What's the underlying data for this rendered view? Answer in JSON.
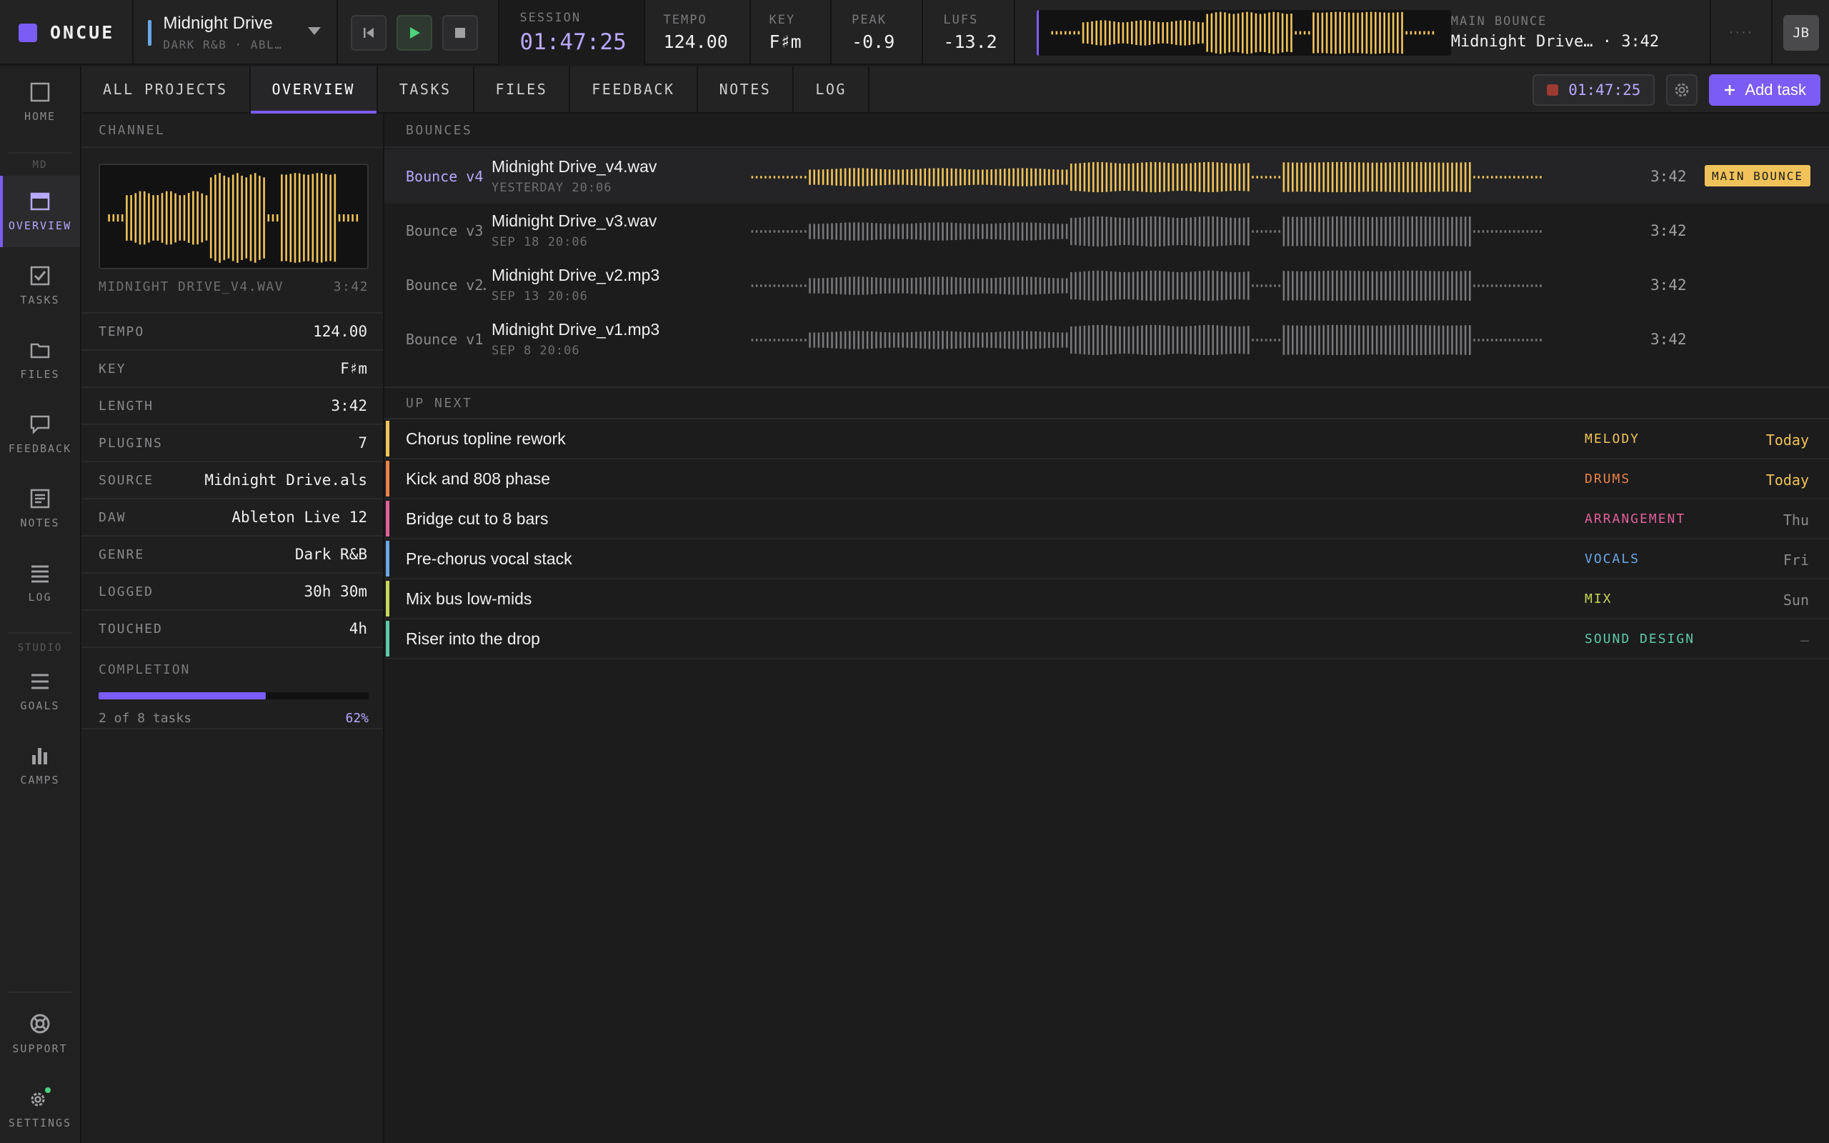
{
  "app": {
    "name": "ONCUE"
  },
  "project": {
    "title": "Midnight Drive",
    "subtitle": "DARK R&B · ABL…"
  },
  "stats": {
    "session": {
      "label": "SESSION",
      "value": "01:47:25"
    },
    "tempo": {
      "label": "TEMPO",
      "value": "124.00"
    },
    "key": {
      "label": "KEY",
      "value": "F♯m"
    },
    "peak": {
      "label": "PEAK",
      "value": "-0.9"
    },
    "lufs": {
      "label": "LUFS",
      "value": "-13.2"
    }
  },
  "main_bounce": {
    "label": "MAIN BOUNCE",
    "name": "Midnight Drive…",
    "length": "· 3:42"
  },
  "more_label": "····",
  "user": {
    "initials": "JB"
  },
  "rail": {
    "items": [
      {
        "label": "HOME",
        "icon": "square-icon"
      },
      {
        "label": "OVERVIEW",
        "icon": "window-icon"
      },
      {
        "label": "TASKS",
        "icon": "checkbox-icon"
      },
      {
        "label": "FILES",
        "icon": "folder-icon"
      },
      {
        "label": "FEEDBACK",
        "icon": "speech-bubble-icon"
      },
      {
        "label": "NOTES",
        "icon": "notes-icon"
      },
      {
        "label": "LOG",
        "icon": "list-icon"
      },
      {
        "label": "GOALS",
        "icon": "goals-icon"
      },
      {
        "label": "CAMPS",
        "icon": "bar-chart-icon"
      },
      {
        "label": "SUPPORT",
        "icon": "lifebuoy-icon"
      },
      {
        "label": "SETTINGS",
        "icon": "gear-icon"
      }
    ],
    "project_badge": "MD",
    "studio_label": "STUDIO"
  },
  "tabs": [
    "ALL PROJECTS",
    "OVERVIEW",
    "TASKS",
    "FILES",
    "FEEDBACK",
    "NOTES",
    "LOG"
  ],
  "active_tab": "OVERVIEW",
  "timer": {
    "value": "01:47:25"
  },
  "add_task": {
    "label": "Add task"
  },
  "channel": {
    "heading": "CHANNEL",
    "file": "MIDNIGHT DRIVE_V4.WAV",
    "length": "3:42",
    "props": [
      {
        "key": "TEMPO",
        "value": "124.00"
      },
      {
        "key": "KEY",
        "value": "F♯m"
      },
      {
        "key": "LENGTH",
        "value": "3:42"
      },
      {
        "key": "PLUGINS",
        "value": "7"
      },
      {
        "key": "SOURCE",
        "value": "Midnight Drive.als"
      },
      {
        "key": "DAW",
        "value": "Ableton Live 12"
      },
      {
        "key": "GENRE",
        "value": "Dark R&B"
      },
      {
        "key": "LOGGED",
        "value": "30h 30m"
      },
      {
        "key": "TOUCHED",
        "value": "4h"
      }
    ],
    "completion": {
      "label": "COMPLETION",
      "summary": "2 of 8 tasks",
      "percent_label": "62%",
      "fraction": 0.62
    }
  },
  "bounces": {
    "heading": "BOUNCES",
    "items": [
      {
        "version": "Bounce v4",
        "name": "Midnight Drive_v4.wav",
        "date": "YESTERDAY 20:06",
        "length": "3:42",
        "badge": "MAIN BOUNCE",
        "active": true
      },
      {
        "version": "Bounce v3",
        "name": "Midnight Drive_v3.wav",
        "date": "SEP 18 20:06",
        "length": "3:42",
        "badge": "",
        "active": false
      },
      {
        "version": "Bounce v2…",
        "name": "Midnight Drive_v2.mp3",
        "date": "SEP 13 20:06",
        "length": "3:42",
        "badge": "",
        "active": false
      },
      {
        "version": "Bounce v1",
        "name": "Midnight Drive_v1.mp3",
        "date": "SEP 8 20:06",
        "length": "3:42",
        "badge": "",
        "active": false
      }
    ]
  },
  "up_next": {
    "heading": "UP NEXT",
    "tasks": [
      {
        "title": "Chorus topline rework",
        "tag": "MELODY",
        "due": "Today",
        "color": "#f0c35a",
        "due_color": "#f0c35a"
      },
      {
        "title": "Kick and 808 phase",
        "tag": "DRUMS",
        "due": "Today",
        "color": "#e8834a",
        "due_color": "#f0c35a"
      },
      {
        "title": "Bridge cut to 8 bars",
        "tag": "ARRANGEMENT",
        "due": "Thu",
        "color": "#e0609a",
        "due_color": "#8a8a8c"
      },
      {
        "title": "Pre-chorus vocal stack",
        "tag": "VOCALS",
        "due": "Fri",
        "color": "#6aa7e6",
        "due_color": "#8a8a8c"
      },
      {
        "title": "Mix bus low-mids",
        "tag": "MIX",
        "due": "Sun",
        "color": "#c8d65a",
        "due_color": "#8a8a8c"
      },
      {
        "title": "Riser into the drop",
        "tag": "SOUND DESIGN",
        "due": "—",
        "color": "#5ec9a8",
        "due_color": "#5a5a5c"
      }
    ]
  },
  "colors": {
    "accent": "#7b5cf5",
    "wave_active": "#f0c35a",
    "wave_inactive": "#77777a"
  }
}
